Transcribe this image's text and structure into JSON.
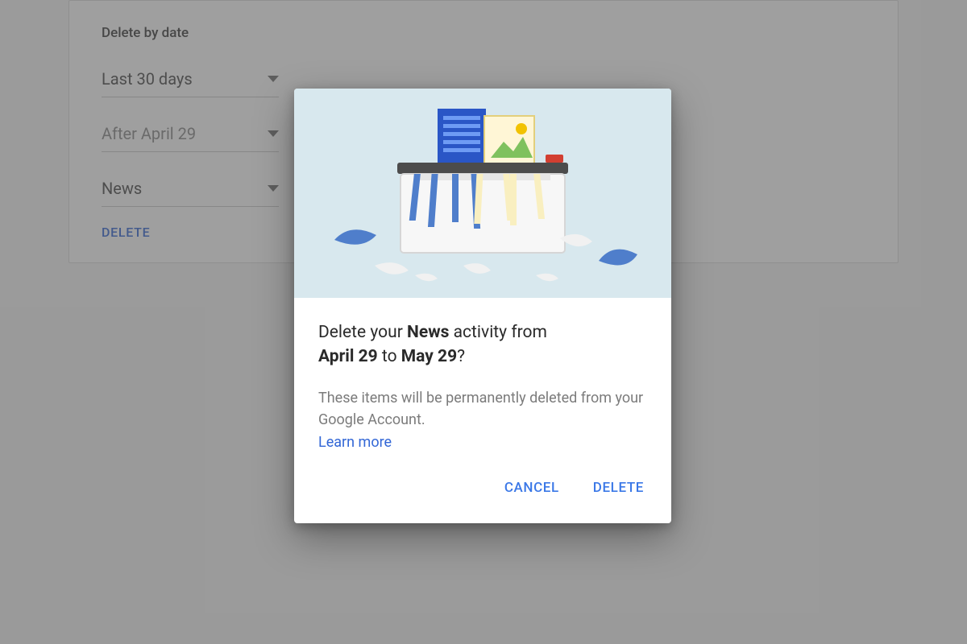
{
  "panel": {
    "title": "Delete by date",
    "range_select": "Last 30 days",
    "after_select": "After April 29",
    "product_select": "News",
    "delete_button": "DELETE"
  },
  "dialog": {
    "headline_prefix": "Delete your ",
    "product_bold": "News",
    "headline_mid": " activity from ",
    "from_bold": "April 29",
    "headline_to": " to ",
    "to_bold": "May 29",
    "headline_suffix": "?",
    "description": "These items will be permanently deleted from your Google Account.",
    "learn_more": "Learn more",
    "cancel": "CANCEL",
    "delete": "DELETE"
  },
  "colors": {
    "accent": "#3b78e7",
    "hero_bg": "#d8e8ee"
  }
}
